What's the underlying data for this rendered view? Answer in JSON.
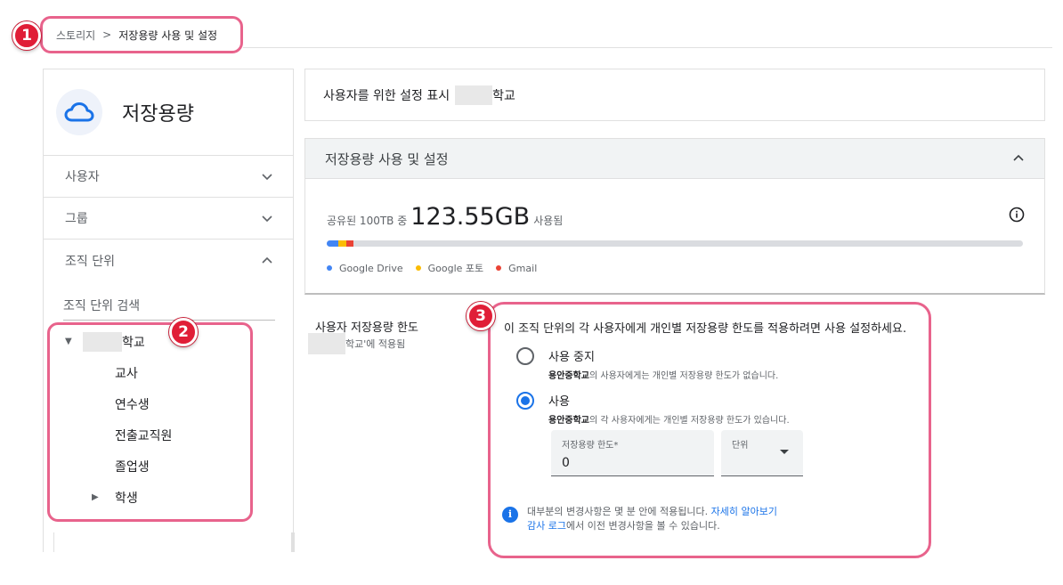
{
  "breadcrumb": {
    "parent": "스토리지",
    "separator": ">",
    "current": "저장용량 사용 및 설정"
  },
  "sidebar": {
    "title": "저장용량",
    "items": [
      {
        "label": "사용자",
        "expanded": false
      },
      {
        "label": "그룹",
        "expanded": false
      },
      {
        "label": "조직 단위",
        "expanded": true
      }
    ],
    "ou_search_placeholder": "조직 단위 검색",
    "tree": [
      {
        "label": "학교",
        "level": 0,
        "caret": "down",
        "redacted": true
      },
      {
        "label": "교사",
        "level": 1
      },
      {
        "label": "연수생",
        "level": 1
      },
      {
        "label": "전출교직원",
        "level": 1
      },
      {
        "label": "졸업생",
        "level": 1
      },
      {
        "label": "학생",
        "level": 1,
        "caret": "right"
      }
    ]
  },
  "org_bar": {
    "prefix": "사용자를 위한 설정 표시",
    "org_suffix": "학교"
  },
  "storage_card": {
    "title": "저장용량 사용 및 설정",
    "usage_prefix": "공유된 100TB 중",
    "usage_value": "123.55GB",
    "usage_suffix": "사용됨",
    "legend": [
      {
        "label": "Google Drive",
        "color": "#4285f4"
      },
      {
        "label": "Google 포토",
        "color": "#fbbc04"
      },
      {
        "label": "Gmail",
        "color": "#ea4335"
      }
    ]
  },
  "limit": {
    "label": "사용자 저장용량 한도",
    "applied_suffix": "학교'에 적용됨",
    "panel_title": "이 조직 단위의 각 사용자에게 개인별 저장용량 한도를 적용하려면 사용 설정하세요.",
    "options": [
      {
        "label": "사용 중지",
        "desc_bold": "용안중학교",
        "desc": "의 사용자에게는 개인별 저장용량 한도가 없습니다.",
        "selected": false
      },
      {
        "label": "사용",
        "desc_bold": "용안중학교",
        "desc": "의 각 사용자에게는 개인별 저장용량 한도가 있습니다.",
        "selected": true
      }
    ],
    "limit_field_label": "저장용량 한도*",
    "limit_field_value": "0",
    "unit_field_label": "단위",
    "note_text": "대부분의 변경사항은 몇 분 안에 적용됩니다.",
    "note_link1": "자세히 알아보기",
    "note_link2": "감사 로그",
    "note_text2": "에서 이전 변경사항을 볼 수 있습니다."
  },
  "badges": [
    "1",
    "2",
    "3"
  ],
  "colors": {
    "highlight": "#e8638c",
    "badge": "#e01e37",
    "accent": "#1a73e8"
  }
}
